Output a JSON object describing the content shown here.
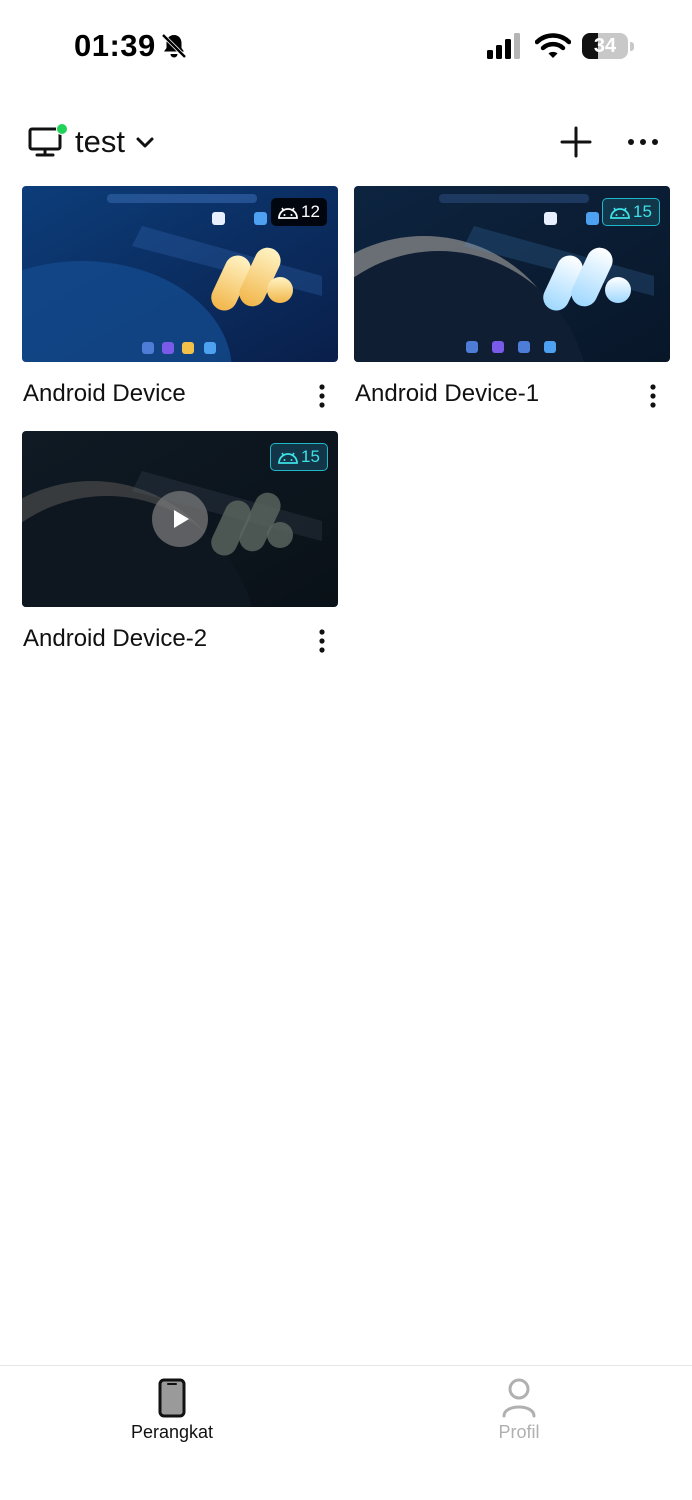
{
  "status_bar": {
    "time": "01:39",
    "battery_percent": "34",
    "battery_level": 0.34
  },
  "header": {
    "workspace_name": "test",
    "workspace_online": true,
    "icons": [
      "monitor-icon",
      "chevron-down-icon",
      "add-icon",
      "more-icon"
    ]
  },
  "devices": [
    {
      "name": "Android Device",
      "android_version": "12",
      "badge_style": "dark",
      "wallpaper": "blue",
      "paused": false
    },
    {
      "name": "Android Device-1",
      "android_version": "15",
      "badge_style": "teal",
      "wallpaper": "moon",
      "paused": false
    },
    {
      "name": "Android Device-2",
      "android_version": "15",
      "badge_style": "teal",
      "wallpaper": "dark-moon",
      "paused": true
    }
  ],
  "tab_bar": {
    "tabs": [
      {
        "label": "Perangkat",
        "icon": "phone-icon",
        "active": true
      },
      {
        "label": "Profil",
        "icon": "person-icon",
        "active": false
      }
    ]
  },
  "colors": {
    "online": "#22d35a",
    "badge_teal": "#3ee0e6",
    "inactive_tab": "#b0b0b0"
  }
}
